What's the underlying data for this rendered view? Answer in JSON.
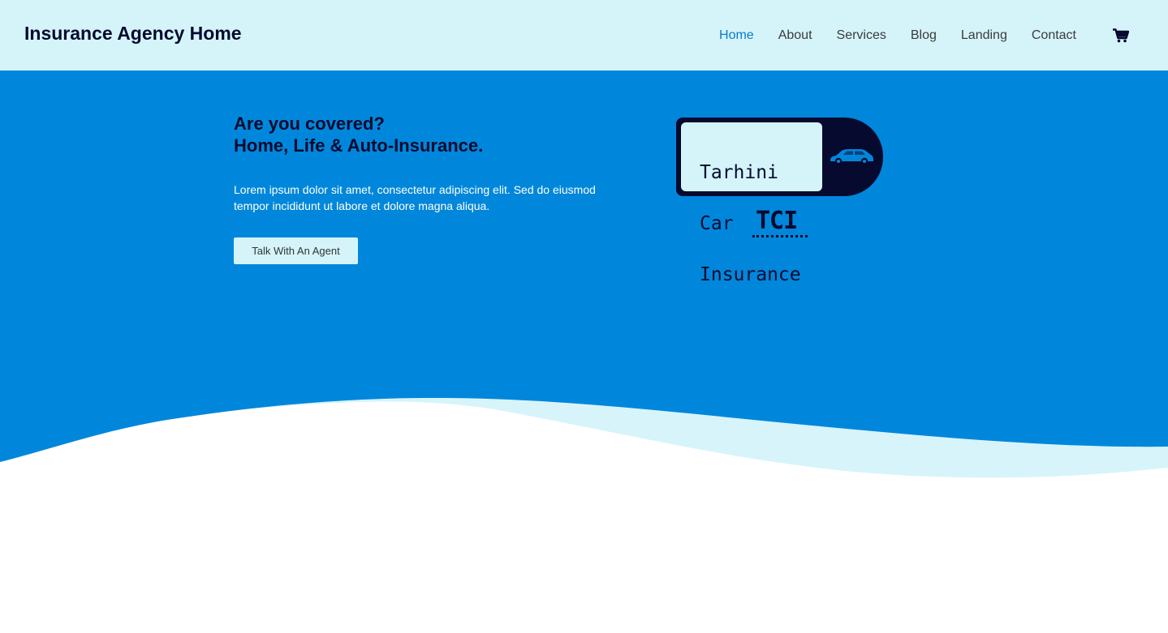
{
  "site": {
    "title": "Insurance Agency Home"
  },
  "nav": {
    "items": [
      {
        "label": "Home",
        "active": true
      },
      {
        "label": "About",
        "active": false
      },
      {
        "label": "Services",
        "active": false
      },
      {
        "label": "Blog",
        "active": false
      },
      {
        "label": "Landing",
        "active": false
      },
      {
        "label": "Contact",
        "active": false
      }
    ],
    "cart_icon": "shopping-cart-icon"
  },
  "hero": {
    "heading_line1": "Are you covered?",
    "heading_line2": "Home, Life & Auto-Insurance.",
    "text": "Lorem ipsum dolor sit amet, consectetur adipiscing elit. Sed do eiusmod tempor incididunt ut labore et dolore magna aliqua.",
    "cta_label": "Talk With An Agent"
  },
  "logo": {
    "line1": "Tarhini",
    "line2": "Car",
    "line3": "Insurance",
    "abbr": "TCI",
    "icon": "car-icon"
  },
  "colors": {
    "header_bg": "#d4f4fa",
    "hero_bg": "#0087db",
    "wave_light": "#d7f4fa",
    "dark_navy": "#060a2e",
    "nav_active": "#0b7ac8"
  }
}
